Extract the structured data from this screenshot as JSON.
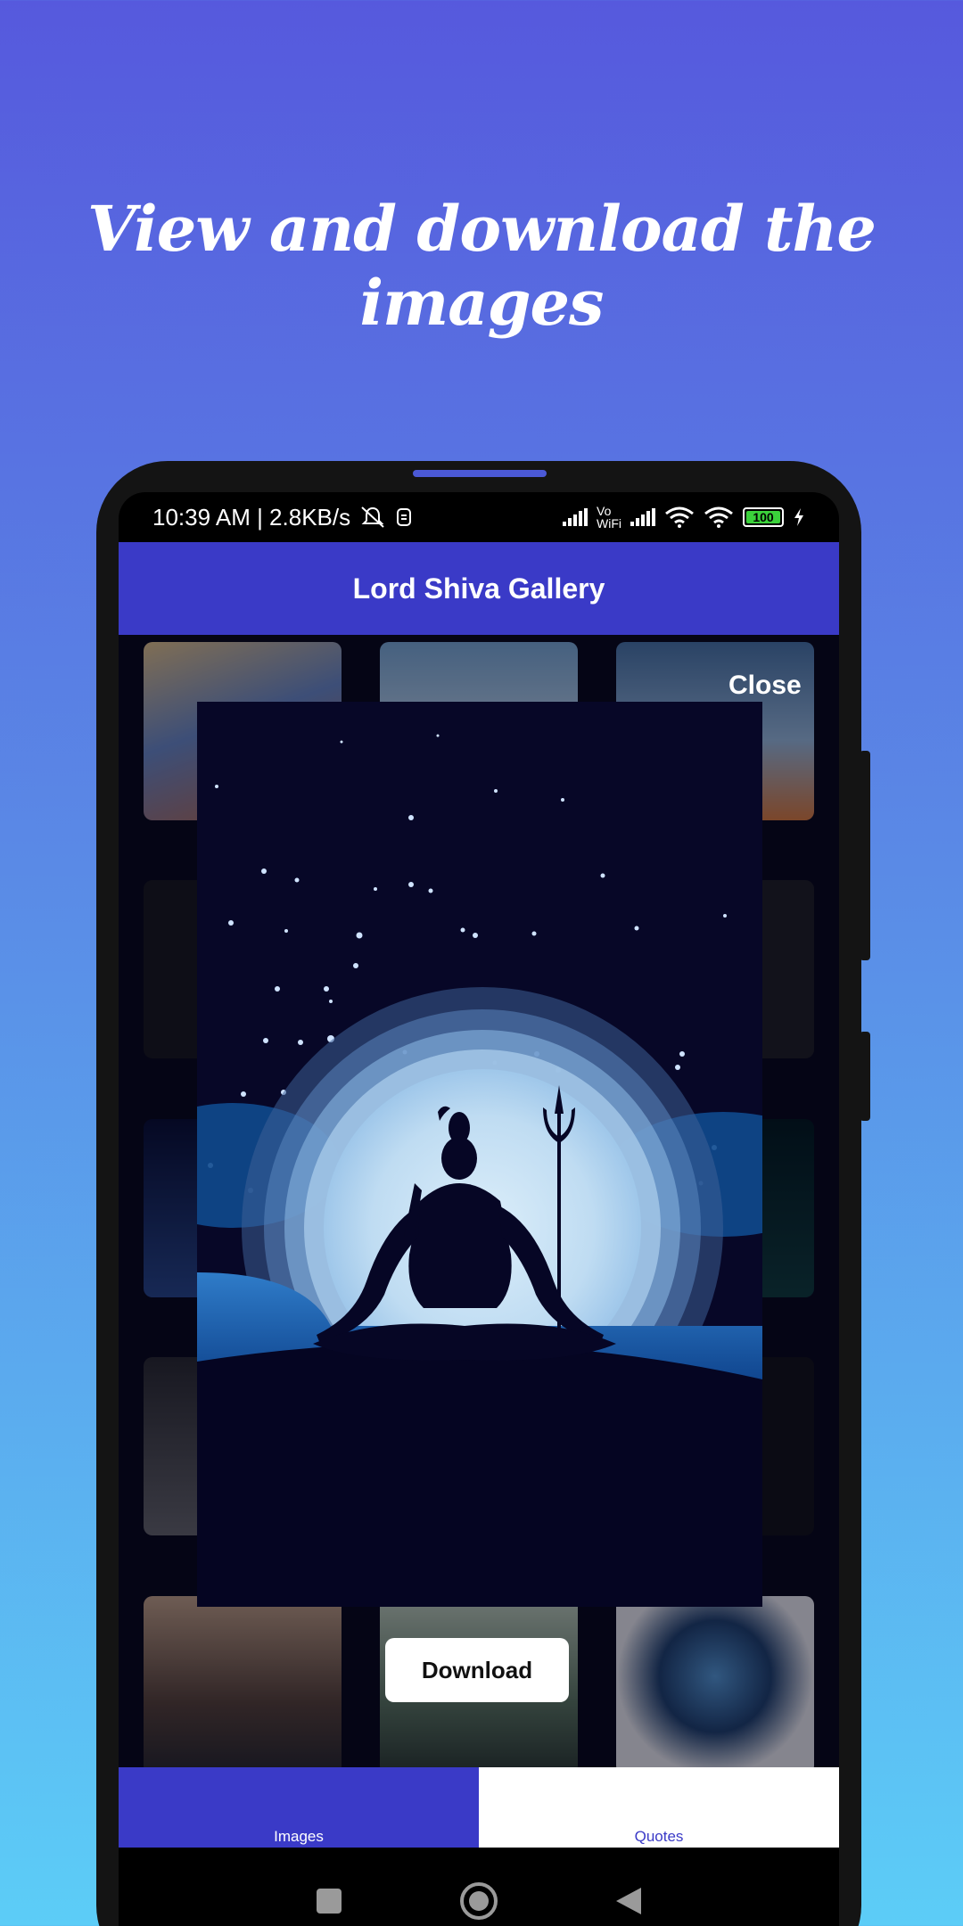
{
  "promo": {
    "headline": "View and download the images"
  },
  "status_bar": {
    "time_speed": "10:39 AM | 2.8KB/s",
    "vowifi_top": "Vo",
    "vowifi_bottom": "WiFi",
    "battery_level": "100"
  },
  "app": {
    "title": "Lord Shiva Gallery"
  },
  "modal": {
    "close_label": "Close",
    "download_label": "Download"
  },
  "tabs": {
    "images_label": "Images",
    "quotes_label": "Quotes"
  },
  "colors": {
    "app_bar": "#3a3ac7",
    "background_top": "#5659dd",
    "background_bottom": "#5ccdf7",
    "modal_bg": "#070727"
  },
  "icons": {
    "status_left": [
      "mute-icon",
      "app-notification-icon"
    ],
    "status_right": [
      "signal-icon",
      "wifi-icon",
      "battery-icon",
      "charging-icon"
    ],
    "nav": [
      "recents-square-icon",
      "home-circle-icon",
      "back-triangle-icon"
    ]
  }
}
